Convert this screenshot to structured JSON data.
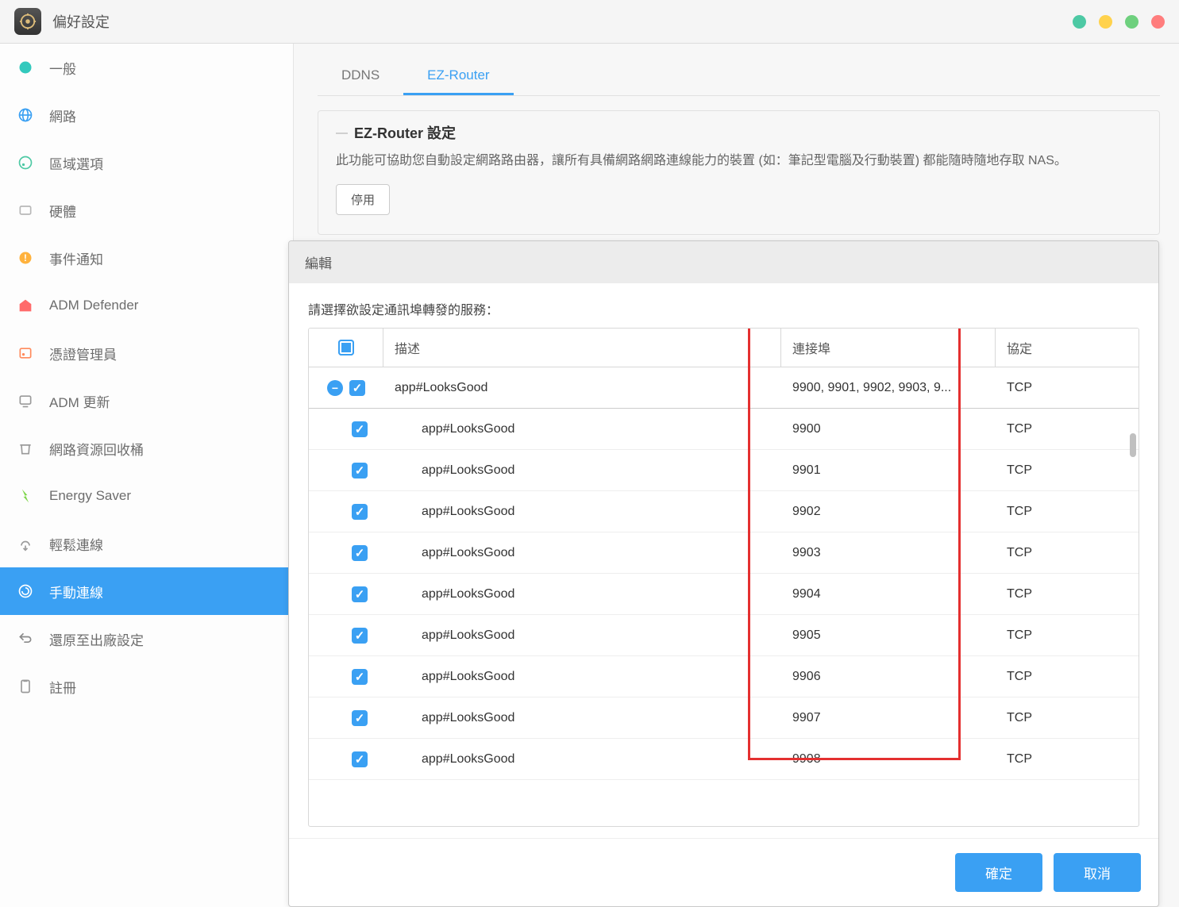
{
  "titlebar": {
    "title": "偏好設定"
  },
  "sidebar": {
    "items": [
      {
        "label": "一般",
        "color": "#33c9bd",
        "active": false
      },
      {
        "label": "網路",
        "color": "#3aa0f3",
        "active": false
      },
      {
        "label": "區域選項",
        "color": "#4dc9a4",
        "active": false
      },
      {
        "label": "硬體",
        "color": "#b8b8b8",
        "active": false
      },
      {
        "label": "事件通知",
        "color": "#ffb23d",
        "active": false
      },
      {
        "label": "ADM Defender",
        "color": "#ff6b6b",
        "active": false
      },
      {
        "label": "憑證管理員",
        "color": "#ff8a5c",
        "active": false
      },
      {
        "label": "ADM 更新",
        "color": "#9a9a9a",
        "active": false
      },
      {
        "label": "網路資源回收桶",
        "color": "#9a9a9a",
        "active": false
      },
      {
        "label": "Energy Saver",
        "color": "#7fd64c",
        "active": false
      },
      {
        "label": "輕鬆連線",
        "color": "#9a9a9a",
        "active": false
      },
      {
        "label": "手動連線",
        "color": "#3aa0f3",
        "active": true
      },
      {
        "label": "還原至出廠設定",
        "color": "#8a8a8a",
        "active": false
      },
      {
        "label": "註冊",
        "color": "#9a9a9a",
        "active": false
      }
    ]
  },
  "content": {
    "tabs": [
      {
        "label": "DDNS",
        "active": false
      },
      {
        "label": "EZ-Router",
        "active": true
      }
    ],
    "panel": {
      "title": "EZ-Router 設定",
      "description": "此功能可協助您自動設定網路路由器，讓所有具備網路網路連線能力的裝置 (如：筆記型電腦及行動裝置) 都能隨時隨地存取 NAS。",
      "disable_label": "停用"
    }
  },
  "modal": {
    "title": "編輯",
    "prompt": "請選擇欲設定通訊埠轉發的服務：",
    "columns": {
      "desc": "描述",
      "port": "連接埠",
      "proto": "協定"
    },
    "group": {
      "desc": "app#LooksGood",
      "port": "9900, 9901, 9902, 9903, 9...",
      "proto": "TCP",
      "checked": true,
      "expanded": true
    },
    "rows": [
      {
        "desc": "app#LooksGood",
        "port": "9900",
        "proto": "TCP",
        "checked": true
      },
      {
        "desc": "app#LooksGood",
        "port": "9901",
        "proto": "TCP",
        "checked": true
      },
      {
        "desc": "app#LooksGood",
        "port": "9902",
        "proto": "TCP",
        "checked": true
      },
      {
        "desc": "app#LooksGood",
        "port": "9903",
        "proto": "TCP",
        "checked": true
      },
      {
        "desc": "app#LooksGood",
        "port": "9904",
        "proto": "TCP",
        "checked": true
      },
      {
        "desc": "app#LooksGood",
        "port": "9905",
        "proto": "TCP",
        "checked": true
      },
      {
        "desc": "app#LooksGood",
        "port": "9906",
        "proto": "TCP",
        "checked": true
      },
      {
        "desc": "app#LooksGood",
        "port": "9907",
        "proto": "TCP",
        "checked": true
      },
      {
        "desc": "app#LooksGood",
        "port": "9908",
        "proto": "TCP",
        "checked": true
      }
    ],
    "buttons": {
      "ok": "確定",
      "cancel": "取消"
    }
  }
}
